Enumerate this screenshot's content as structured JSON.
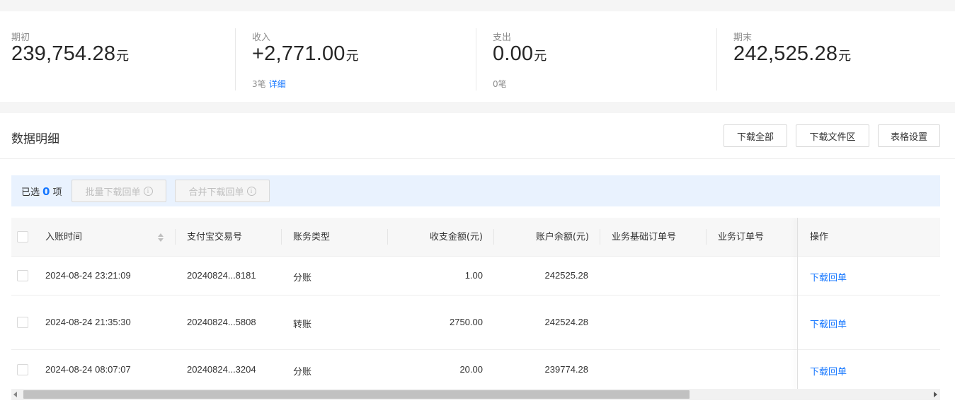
{
  "summary": {
    "opening": {
      "label": "期初",
      "amount": "239,754.28",
      "unit": "元"
    },
    "income": {
      "label": "收入",
      "amount": "+2,771.00",
      "unit": "元",
      "count": "3笔",
      "detail_link": "详细"
    },
    "expense": {
      "label": "支出",
      "amount": "0.00",
      "unit": "元",
      "count": "0笔"
    },
    "closing": {
      "label": "期末",
      "amount": "242,525.28",
      "unit": "元"
    }
  },
  "detail": {
    "title": "数据明细",
    "buttons": {
      "download_all": "下载全部",
      "download_files": "下载文件区",
      "table_settings": "表格设置"
    }
  },
  "selection": {
    "prefix": "已选",
    "count": "0",
    "suffix": "项",
    "batch_download": "批量下载回单",
    "merge_download": "合并下载回单",
    "info_glyph": "i"
  },
  "table": {
    "columns": [
      "入账时间",
      "支付宝交易号",
      "账务类型",
      "收支金额(元)",
      "账户余额(元)",
      "业务基础订单号",
      "业务订单号",
      "操作"
    ],
    "rows": [
      {
        "time": "2024-08-24 23:21:09",
        "trade_no": "20240824...8181",
        "type": "分账",
        "amount": "1.00",
        "balance": "242525.28",
        "base_order": "",
        "order": "",
        "action": "下载回单"
      },
      {
        "time": "2024-08-24 21:35:30",
        "trade_no": "20240824...5808",
        "type": "转账",
        "amount": "2750.00",
        "balance": "242524.28",
        "base_order": "",
        "order": "",
        "action": "下载回单"
      },
      {
        "time": "2024-08-24 08:07:07",
        "trade_no": "20240824...3204",
        "type": "分账",
        "amount": "20.00",
        "balance": "239774.28",
        "base_order": "",
        "order": "",
        "action": "下载回单"
      }
    ]
  },
  "colors": {
    "accent": "#1677ff",
    "selection_bg": "#e9f2fe",
    "page_bg": "#f5f5f5"
  },
  "icons": [
    "info-icon",
    "sort-icon",
    "scroll-left-arrow-icon",
    "scroll-right-arrow-icon"
  ]
}
